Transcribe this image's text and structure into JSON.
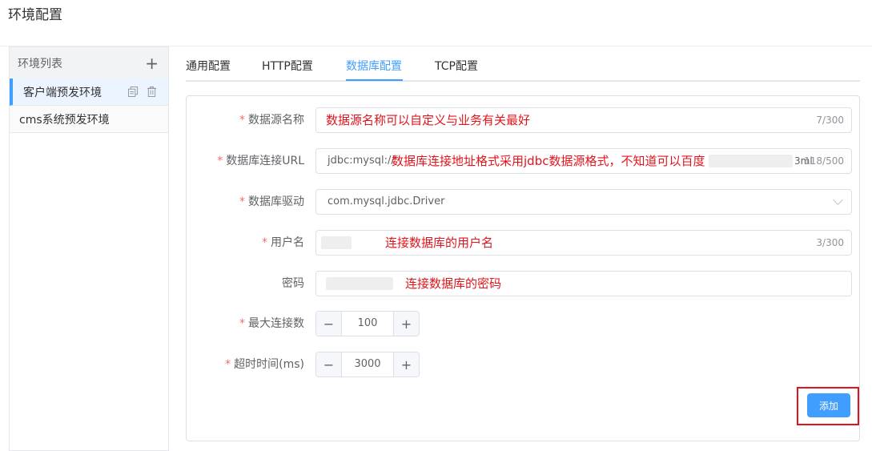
{
  "page": {
    "title": "环境配置"
  },
  "sidebar": {
    "title": "环境列表",
    "items": [
      {
        "label": "客户端预发环境"
      },
      {
        "label": "cms系统预发环境"
      }
    ]
  },
  "tabs": [
    {
      "label": "通用配置"
    },
    {
      "label": "HTTP配置"
    },
    {
      "label": "数据库配置"
    },
    {
      "label": "TCP配置"
    }
  ],
  "form": {
    "datasource_name": {
      "label": "数据源名称",
      "count": "7/300",
      "note": "数据源名称可以自定义与业务有关最好"
    },
    "url": {
      "label": "数据库连接URL",
      "value": "jdbc:mysql://",
      "value_tail": "3ml",
      "count": "118/500",
      "note": "数据库连接地址格式采用jdbc数据源格式，不知道可以百度"
    },
    "driver": {
      "label": "数据库驱动",
      "value": "com.mysql.jdbc.Driver"
    },
    "username": {
      "label": "用户名",
      "count": "3/300",
      "note": "连接数据库的用户名"
    },
    "password": {
      "label": "密码",
      "note": "连接数据库的密码"
    },
    "max_conn": {
      "label": "最大连接数",
      "value": "100",
      "minus": "−",
      "plus": "+"
    },
    "timeout": {
      "label": "超时时间(ms)",
      "value": "3000",
      "minus": "−",
      "plus": "+"
    },
    "required_mark": "*",
    "submit_label": "添加"
  }
}
